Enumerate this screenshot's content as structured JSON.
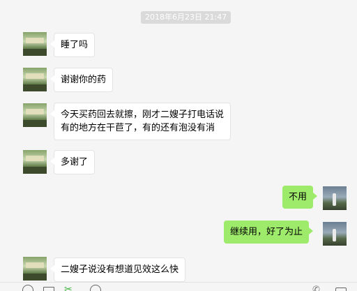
{
  "chat": {
    "timestamp": "2018年6月23日 21:47",
    "messages": [
      {
        "side": "left",
        "text": "睡了吗"
      },
      {
        "side": "left",
        "text": "谢谢你的药"
      },
      {
        "side": "left",
        "lines": [
          "今天买药回去就擦，刚才二嫂子打电话说",
          "有的地方在干苣了，有的还有泡没有消"
        ]
      },
      {
        "side": "left",
        "text": "多谢了"
      },
      {
        "side": "right",
        "text": "不用"
      },
      {
        "side": "right",
        "text": "继续用，好了为止"
      },
      {
        "side": "left",
        "text": "二嫂子说没有想道见效这么快"
      }
    ]
  },
  "toolbar": {
    "icons": [
      "emoji-icon",
      "folder-icon",
      "scissors-icon",
      "chat-history-icon",
      "phone-icon",
      "video-icon"
    ],
    "accent": "#3bb33b"
  },
  "colors": {
    "background": "#f5f5f5",
    "bubble_in": "#ffffff",
    "bubble_out": "#9eea6a",
    "timestamp_bg": "#dadada"
  }
}
